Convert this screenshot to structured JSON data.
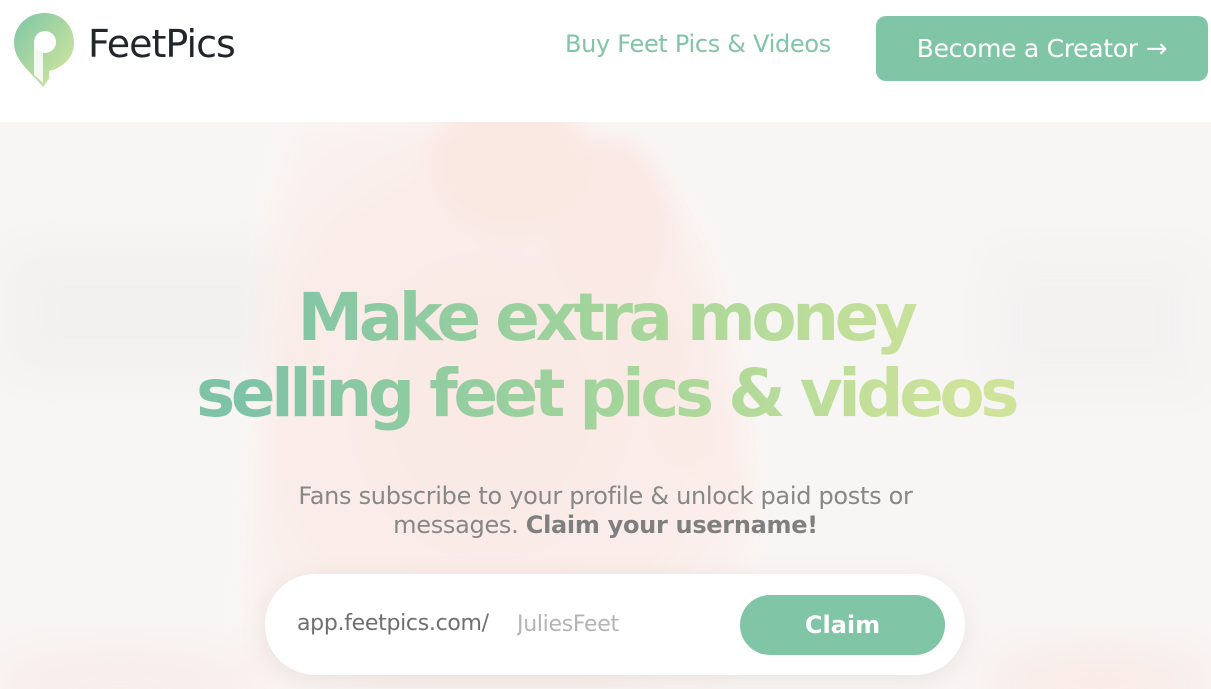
{
  "header": {
    "brand": "FeetPics",
    "nav_link": "Buy Feet Pics & Videos",
    "cta_label": "Become a Creator",
    "cta_arrow": "→"
  },
  "hero": {
    "headline_line1": "Make extra money",
    "headline_line2": "selling feet pics & videos",
    "subtext_line1": "Fans subscribe to your profile & unlock paid posts or",
    "subtext_line2": "messages.",
    "subtext_bold": "Claim your username!"
  },
  "claim": {
    "url_prefix": "app.feetpics.com/",
    "placeholder": "JuliesFeet",
    "button_label": "Claim"
  },
  "colors": {
    "accent": "#80c5a5",
    "accent_light": "#cfe39a",
    "brand_text": "#22262b",
    "muted_text": "#878787"
  },
  "icons": {
    "logo": "map-pin-logo-icon",
    "cta_arrow": "right-arrow-icon"
  }
}
